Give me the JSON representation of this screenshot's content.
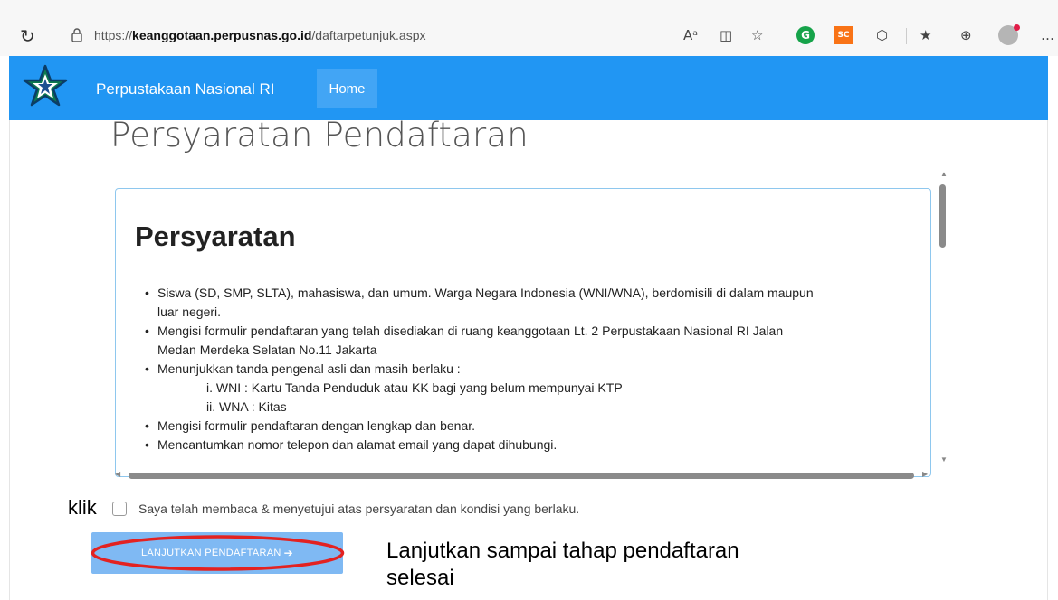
{
  "browser": {
    "url_prefix": "https://",
    "url_domain": "keanggotaan.perpusnas.go.id",
    "url_path": "/daftarpetunjuk.aspx",
    "reload_icon": "reload-icon",
    "lock_icon": "lock-icon",
    "toolbar": {
      "read_aloud": "Aᵃ",
      "split": "◫",
      "favorite": "☆",
      "grammarly": "G",
      "sc": "SC",
      "extensions": "⬡",
      "favorites_list": "★",
      "collections": "⊕",
      "more": "…"
    }
  },
  "site": {
    "brand": "Perpustakaan Nasional RI",
    "home": "Home",
    "colors": {
      "navbar": "#2196f3",
      "home_active": "#42a5f5",
      "panel_border": "#8ec7ee",
      "button": "#7fb9f3",
      "ellipse": "#e32221"
    }
  },
  "page": {
    "title": "Persyaratan Pendaftaran",
    "panel_heading": "Persyaratan",
    "requirements": {
      "r1_a": "Siswa (SD, SMP, SLTA), mahasiswa, dan umum. Warga Negara Indonesia (WNI/WNA), berdomisili di dalam maupun",
      "r1_b": "luar negeri.",
      "r2_a": "Mengisi formulir pendaftaran yang telah disediakan di ruang keanggotaan Lt. 2  Perpustakaan Nasional RI Jalan",
      "r2_b": "Medan Merdeka Selatan No.11 Jakarta",
      "r3": "Menunjukkan tanda pengenal asli dan masih berlaku :",
      "r3_i": "i. WNI : Kartu Tanda Penduduk atau KK bagi yang belum mempunyai KTP",
      "r3_ii": "ii. WNA : Kitas",
      "r4": "Mengisi formulir pendaftaran dengan lengkap dan benar.",
      "r5": "Mencantumkan nomor telepon dan alamat email yang dapat dihubungi."
    },
    "agree_text": "Saya telah membaca & menyetujui atas persyaratan dan kondisi yang berlaku.",
    "continue_label": "LANJUTKAN PENDAFTARAN",
    "continue_arrow": "➔"
  },
  "annotations": {
    "klik": "klik",
    "instruction": "Lanjutkan sampai tahap pendaftaran selesai"
  }
}
